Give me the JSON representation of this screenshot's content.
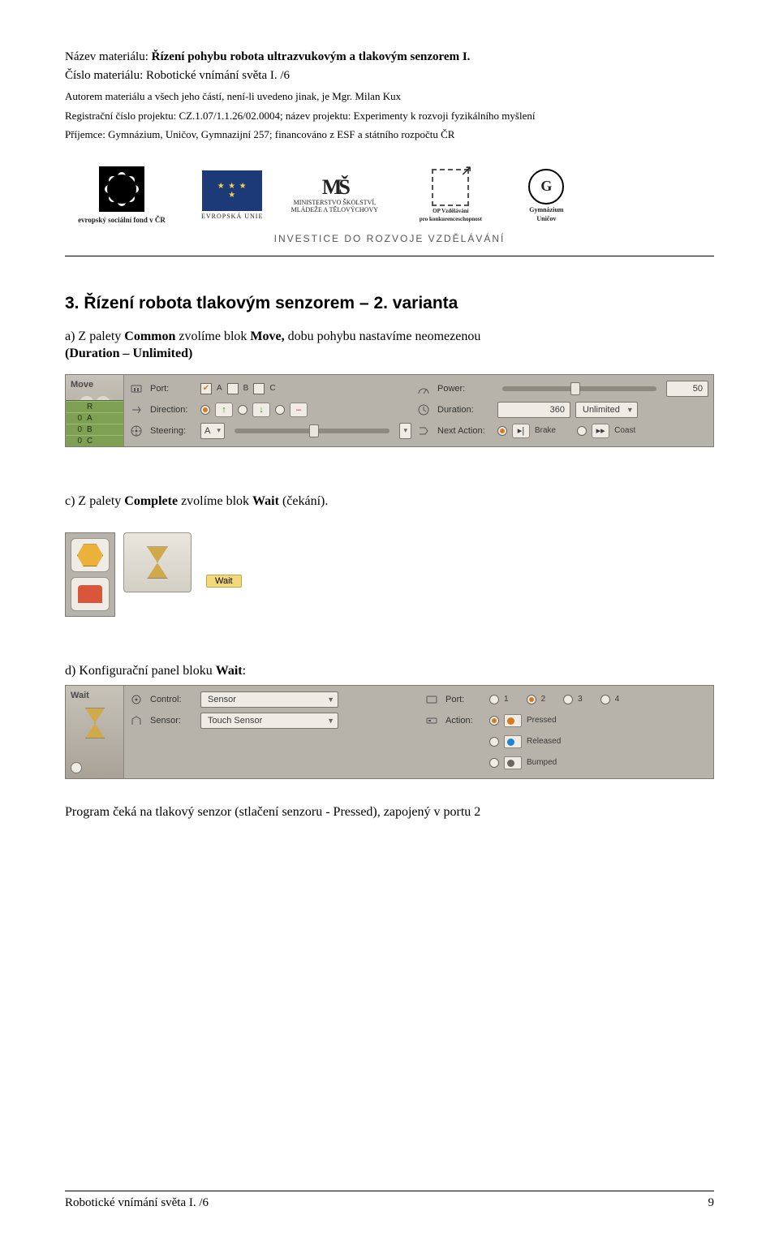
{
  "header": {
    "name_label": "Název materiálu: ",
    "name_value": "Řízení pohybu robota ultrazvukovým a tlakovým senzorem I.",
    "num_label": "Číslo materiálu: Robotické vnímání světa I. /6",
    "author_line": "Autorem materiálu a všech jeho částí, není-li uvedeno jinak, je Mgr. Milan Kux",
    "reg_line": "Registrační číslo projektu: CZ.1.07/1.1.26/02.0004; název projektu: Experimenty k rozvoji fyzikálního myšlení",
    "recipient_line": "Příjemce: Gymnázium, Uničov, Gymnazijní 257; financováno z ESF a státního rozpočtu ČR"
  },
  "logos": {
    "esf": "evropský sociální fond v ČR",
    "eu": "EVROPSKÁ UNIE",
    "msmt_top": "MINISTERSTVO ŠKOLSTVÍ,",
    "msmt_bot": "MLÁDEŽE A TĚLOVÝCHOVY",
    "opvk1": "OP Vzdělávání",
    "opvk2": "pro konkurenceschopnost",
    "gym1": "Gymnázium",
    "gym2": "Uničov",
    "invest": "INVESTICE DO ROZVOJE VZDĚLÁVÁNÍ"
  },
  "section_heading": "3. Řízení robota tlakovým senzorem – 2. varianta",
  "para_a_pre": "a) Z palety ",
  "para_a_b1": "Common",
  "para_a_mid": " zvolíme blok ",
  "para_a_b2": "Move, ",
  "para_a_post": "dobu pohybu nastavíme neomezenou ",
  "para_a_b3": "(Duration – Unlimited)",
  "move_panel": {
    "name": "Move",
    "rows": {
      "port": "Port:",
      "direction": "Direction:",
      "steering": "Steering:",
      "power": "Power:",
      "duration": "Duration:",
      "next": "Next Action:"
    },
    "ports": {
      "A": "A",
      "B": "B",
      "C": "C"
    },
    "steer_opt": "A",
    "power_val": "50",
    "dur_val": "360",
    "dur_unit": "Unlimited",
    "brake": "Brake",
    "coast": "Coast",
    "side": {
      "R": "R",
      "A": "A",
      "B": "B",
      "C": "C",
      "z": "0"
    }
  },
  "para_c_pre": "c)  Z palety ",
  "para_c_b1": "Complete",
  "para_c_mid": " zvolíme blok ",
  "para_c_b2": "Wait",
  "para_c_post": " (čekání).",
  "wait_tooltip": "Wait",
  "para_d_pre": "d) Konfigurační panel bloku ",
  "para_d_b1": "Wait",
  "para_d_post": ":",
  "wait_panel": {
    "name": "Wait",
    "control": "Control:",
    "sensor": "Sensor:",
    "control_val": "Sensor",
    "sensor_val": "Touch Sensor",
    "port": "Port:",
    "action": "Action:",
    "ports": {
      "p1": "1",
      "p2": "2",
      "p3": "3",
      "p4": "4"
    },
    "pressed": "Pressed",
    "released": "Released",
    "bumped": "Bumped"
  },
  "para_prog": "Program čeká na tlakový senzor (stlačení  senzoru - Pressed), zapojený v portu 2",
  "footer_left": "Robotické vnímání světa I. /6",
  "footer_page": "9"
}
